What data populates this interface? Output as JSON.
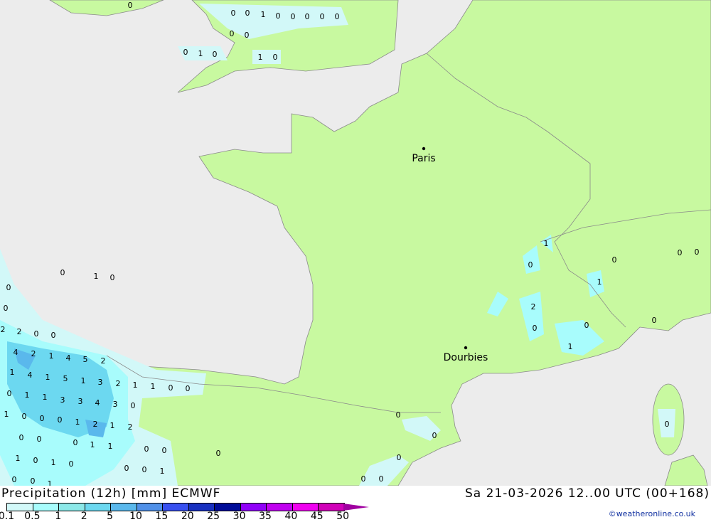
{
  "header": {
    "title": "Precipitation (12h) [mm] ECMWF",
    "datetime": "Sa 21-03-2026 12..00 UTC (00+168)",
    "copyright": "©weatheronline.co.uk"
  },
  "legend": {
    "ticks": [
      "0.1",
      "0.5",
      "1",
      "2",
      "5",
      "10",
      "15",
      "20",
      "25",
      "30",
      "35",
      "40",
      "45",
      "50"
    ],
    "colors": [
      "#d2f8f8",
      "#a8fcfc",
      "#8ce8e8",
      "#6cd8f0",
      "#5ab8ec",
      "#5090e8",
      "#3850f0",
      "#1830c0",
      "#000c98",
      "#9000f8",
      "#c000f0",
      "#f000f0",
      "#d000b8"
    ],
    "tip_color": "#a000a0"
  },
  "map": {
    "sea_color": "#ececec",
    "land_color": "#c8f9a0",
    "cities": [
      {
        "name": "Paris"
      },
      {
        "name": "Dourbies"
      }
    ],
    "values": [
      "0",
      "0",
      "0",
      "1",
      "0",
      "0",
      "0",
      "0",
      "0",
      "0",
      "0",
      "0",
      "1",
      "0",
      "1",
      "0",
      "0",
      "1",
      "0",
      "0",
      "0",
      "2",
      "2",
      "0",
      "0",
      "4",
      "2",
      "1",
      "4",
      "5",
      "2",
      "1",
      "4",
      "1",
      "5",
      "1",
      "3",
      "2",
      "1",
      "1",
      "0",
      "0",
      "0",
      "1",
      "1",
      "3",
      "3",
      "4",
      "3",
      "0",
      "1",
      "0",
      "0",
      "0",
      "1",
      "2",
      "1",
      "2",
      "0",
      "0",
      "0",
      "1",
      "1",
      "0",
      "0",
      "0",
      "1",
      "0",
      "1",
      "0",
      "0",
      "0",
      "1",
      "0",
      "0",
      "1",
      "1",
      "0",
      "0",
      "0",
      "0",
      "1",
      "2",
      "0",
      "0",
      "0",
      "1",
      "0",
      "0",
      "0",
      "0",
      "0",
      "0"
    ]
  }
}
